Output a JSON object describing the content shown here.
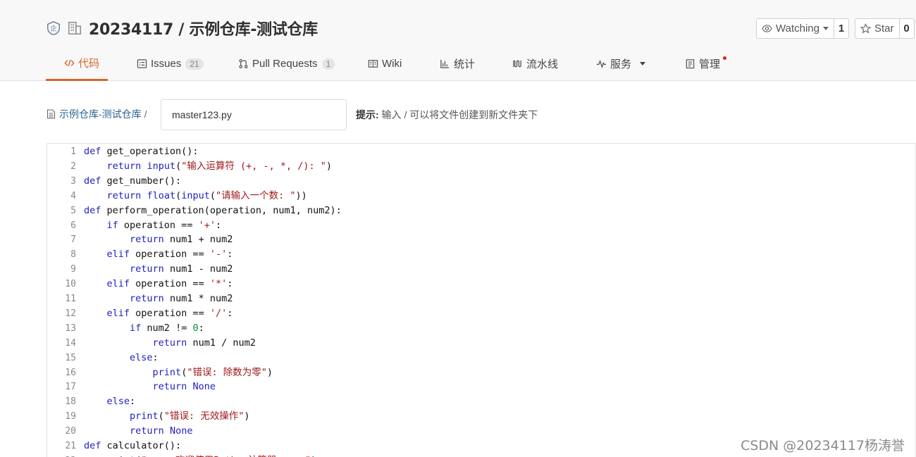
{
  "header": {
    "repo_title": "20234117 / 示例仓库-测试仓库",
    "watch": {
      "label": "Watching",
      "count": "1"
    },
    "star": {
      "label": "Star",
      "count": "0"
    }
  },
  "tabs": [
    {
      "label": "代码",
      "icon": "code-icon",
      "active": true
    },
    {
      "label": "Issues",
      "icon": "issues-icon",
      "badge": "21"
    },
    {
      "label": "Pull Requests",
      "icon": "pull-request-icon",
      "badge": "1"
    },
    {
      "label": "Wiki",
      "icon": "book-icon"
    },
    {
      "label": "统计",
      "icon": "bar-chart-icon"
    },
    {
      "label": "流水线",
      "icon": "pipeline-icon"
    },
    {
      "label": "服务",
      "icon": "pulse-icon"
    },
    {
      "label": "管理",
      "icon": "clipboard-icon"
    }
  ],
  "path": {
    "repo_link": "示例仓库-测试仓库",
    "separator": "/",
    "filename": "master123.py",
    "hint_label": "提示:",
    "hint_text": " 输入 / 可以将文件创建到新文件夹下"
  },
  "code_lines": [
    [
      [
        "kw",
        "def"
      ],
      [
        "n",
        " get_operation():"
      ]
    ],
    [
      [
        "n",
        "    "
      ],
      [
        "kw",
        "return"
      ],
      [
        "n",
        " "
      ],
      [
        "bi",
        "input"
      ],
      [
        "n",
        "("
      ],
      [
        "str",
        "\"输入运算符 (+, -, *, /): \""
      ],
      [
        "n",
        ")"
      ]
    ],
    [
      [
        "kw",
        "def"
      ],
      [
        "n",
        " get_number():"
      ]
    ],
    [
      [
        "n",
        "    "
      ],
      [
        "kw",
        "return"
      ],
      [
        "n",
        " "
      ],
      [
        "bi",
        "float"
      ],
      [
        "n",
        "("
      ],
      [
        "bi",
        "input"
      ],
      [
        "n",
        "("
      ],
      [
        "str",
        "\"请输入一个数: \""
      ],
      [
        "n",
        "))"
      ]
    ],
    [
      [
        "kw",
        "def"
      ],
      [
        "n",
        " perform_operation(operation, num1, num2):"
      ]
    ],
    [
      [
        "n",
        "    "
      ],
      [
        "kw",
        "if"
      ],
      [
        "n",
        " operation == "
      ],
      [
        "str",
        "'+'"
      ],
      [
        "n",
        ":"
      ]
    ],
    [
      [
        "n",
        "        "
      ],
      [
        "kw",
        "return"
      ],
      [
        "n",
        " num1 + num2"
      ]
    ],
    [
      [
        "n",
        "    "
      ],
      [
        "kw",
        "elif"
      ],
      [
        "n",
        " operation == "
      ],
      [
        "str",
        "'-'"
      ],
      [
        "n",
        ":"
      ]
    ],
    [
      [
        "n",
        "        "
      ],
      [
        "kw",
        "return"
      ],
      [
        "n",
        " num1 - num2"
      ]
    ],
    [
      [
        "n",
        "    "
      ],
      [
        "kw",
        "elif"
      ],
      [
        "n",
        " operation == "
      ],
      [
        "str",
        "'*'"
      ],
      [
        "n",
        ":"
      ]
    ],
    [
      [
        "n",
        "        "
      ],
      [
        "kw",
        "return"
      ],
      [
        "n",
        " num1 * num2"
      ]
    ],
    [
      [
        "n",
        "    "
      ],
      [
        "kw",
        "elif"
      ],
      [
        "n",
        " operation == "
      ],
      [
        "str",
        "'/'"
      ],
      [
        "n",
        ":"
      ]
    ],
    [
      [
        "n",
        "        "
      ],
      [
        "kw",
        "if"
      ],
      [
        "n",
        " num2 != "
      ],
      [
        "num",
        "0"
      ],
      [
        "n",
        ":"
      ]
    ],
    [
      [
        "n",
        "            "
      ],
      [
        "kw",
        "return"
      ],
      [
        "n",
        " num1 / num2"
      ]
    ],
    [
      [
        "n",
        "        "
      ],
      [
        "kw",
        "else"
      ],
      [
        "n",
        ":"
      ]
    ],
    [
      [
        "n",
        "            "
      ],
      [
        "bi",
        "print"
      ],
      [
        "n",
        "("
      ],
      [
        "str",
        "\"错误: 除数为零\""
      ],
      [
        "n",
        ")"
      ]
    ],
    [
      [
        "n",
        "            "
      ],
      [
        "kw",
        "return"
      ],
      [
        "n",
        " "
      ],
      [
        "kw",
        "None"
      ]
    ],
    [
      [
        "n",
        "    "
      ],
      [
        "kw",
        "else"
      ],
      [
        "n",
        ":"
      ]
    ],
    [
      [
        "n",
        "        "
      ],
      [
        "bi",
        "print"
      ],
      [
        "n",
        "("
      ],
      [
        "str",
        "\"错误: 无效操作\""
      ],
      [
        "n",
        ")"
      ]
    ],
    [
      [
        "n",
        "        "
      ],
      [
        "kw",
        "return"
      ],
      [
        "n",
        " "
      ],
      [
        "kw",
        "None"
      ]
    ],
    [
      [
        "kw",
        "def"
      ],
      [
        "n",
        " calculator():"
      ]
    ],
    [
      [
        "n",
        "    "
      ],
      [
        "bi",
        "print"
      ],
      [
        "n",
        "("
      ],
      [
        "str",
        "\"-----欢迎使用Python计算器-----\""
      ],
      [
        "n",
        ")"
      ]
    ]
  ],
  "watermark": "CSDN @20234117杨涛誉",
  "colors": {
    "accent": "#d9662a",
    "keyword": "#2020c4",
    "string": "#a11a1a",
    "number": "#118844"
  }
}
